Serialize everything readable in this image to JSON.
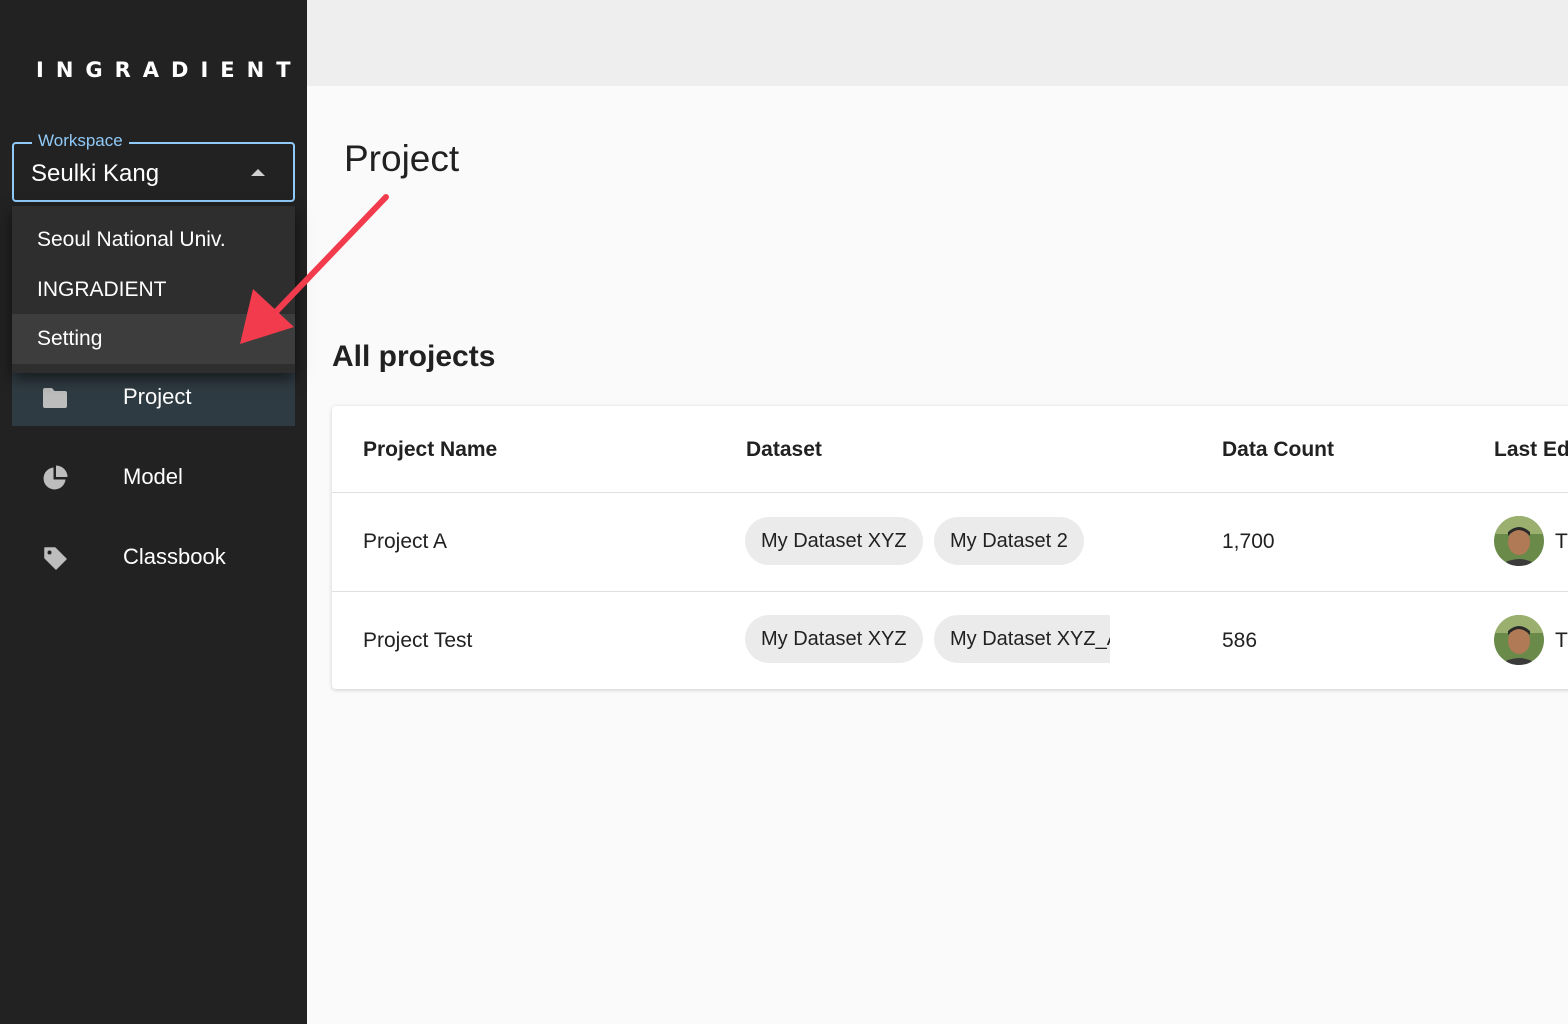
{
  "brand": {
    "logo_text": "INGRADIENT"
  },
  "workspace": {
    "label": "Workspace",
    "value": "Seulki Kang",
    "menu": [
      {
        "label": "Seoul National Univ."
      },
      {
        "label": "INGRADIENT"
      },
      {
        "label": "Setting",
        "selected": true
      }
    ]
  },
  "nav": [
    {
      "label": "Project",
      "icon": "folder-icon",
      "active": true
    },
    {
      "label": "Model",
      "icon": "pie-chart-icon",
      "active": false
    },
    {
      "label": "Classbook",
      "icon": "tag-icon",
      "active": false
    }
  ],
  "page": {
    "title": "Project",
    "section_title": "All projects"
  },
  "table": {
    "columns": [
      "Project Name",
      "Dataset",
      "Data Count",
      "Last Ed"
    ],
    "rows": [
      {
        "name": "Project A",
        "datasets": [
          "My Dataset XYZ",
          "My Dataset 2"
        ],
        "data_count": "1,700",
        "editor_initial": "T"
      },
      {
        "name": "Project Test",
        "datasets": [
          "My Dataset XYZ",
          "My Dataset XYZ_A"
        ],
        "data_count": "586",
        "editor_initial": "T"
      }
    ]
  },
  "colors": {
    "sidebar_bg": "#222222",
    "accent": "#90caf9",
    "annotation_arrow": "#f23b4c",
    "active_nav_bg": "#2f3b42"
  }
}
